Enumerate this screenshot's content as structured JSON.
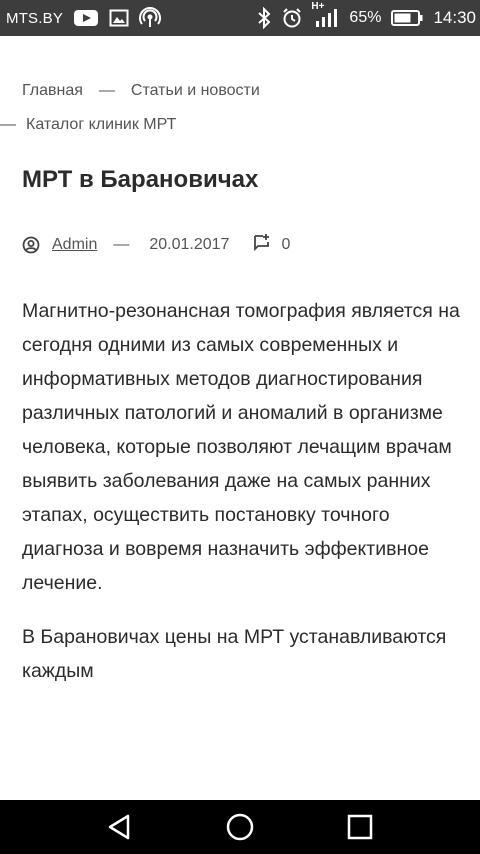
{
  "status_bar": {
    "carrier": "MTS.BY",
    "network_type": "H+",
    "battery": "65%",
    "time": "14:30",
    "icons": [
      "youtube-icon",
      "image-icon",
      "hotspot-icon",
      "bluetooth-icon",
      "alarm-icon",
      "signal-icon",
      "battery-icon"
    ]
  },
  "breadcrumb": {
    "home": "Главная",
    "separator": "—",
    "section": "Статьи и новости",
    "catalog": "Каталог клиник МРТ"
  },
  "article": {
    "title": "МРТ в Барановичах",
    "author": "Admin",
    "meta_separator": "—",
    "date": "20.01.2017",
    "comments_count": "0",
    "paragraphs": [
      "Магнитно-резонансная томография является на сегодня одними из самых современных и информативных методов диагностирования различных патологий и аномалий в организме человека, которые позволяют лечащим врачам выявить заболевания даже на самых ранних этапах, осуществить постановку точного диагноза и вовремя назначить эффективное лечение.",
      "В Барановичах цены на МРТ устанавливаются каждым"
    ]
  },
  "nav_bar": {
    "icons": [
      "back-icon",
      "home-icon",
      "recents-icon"
    ]
  },
  "colors": {
    "status_bar_bg": "#3d3d3d",
    "nav_bar_bg": "#000000",
    "text": "#2b2b2b",
    "muted_text": "#555555"
  }
}
